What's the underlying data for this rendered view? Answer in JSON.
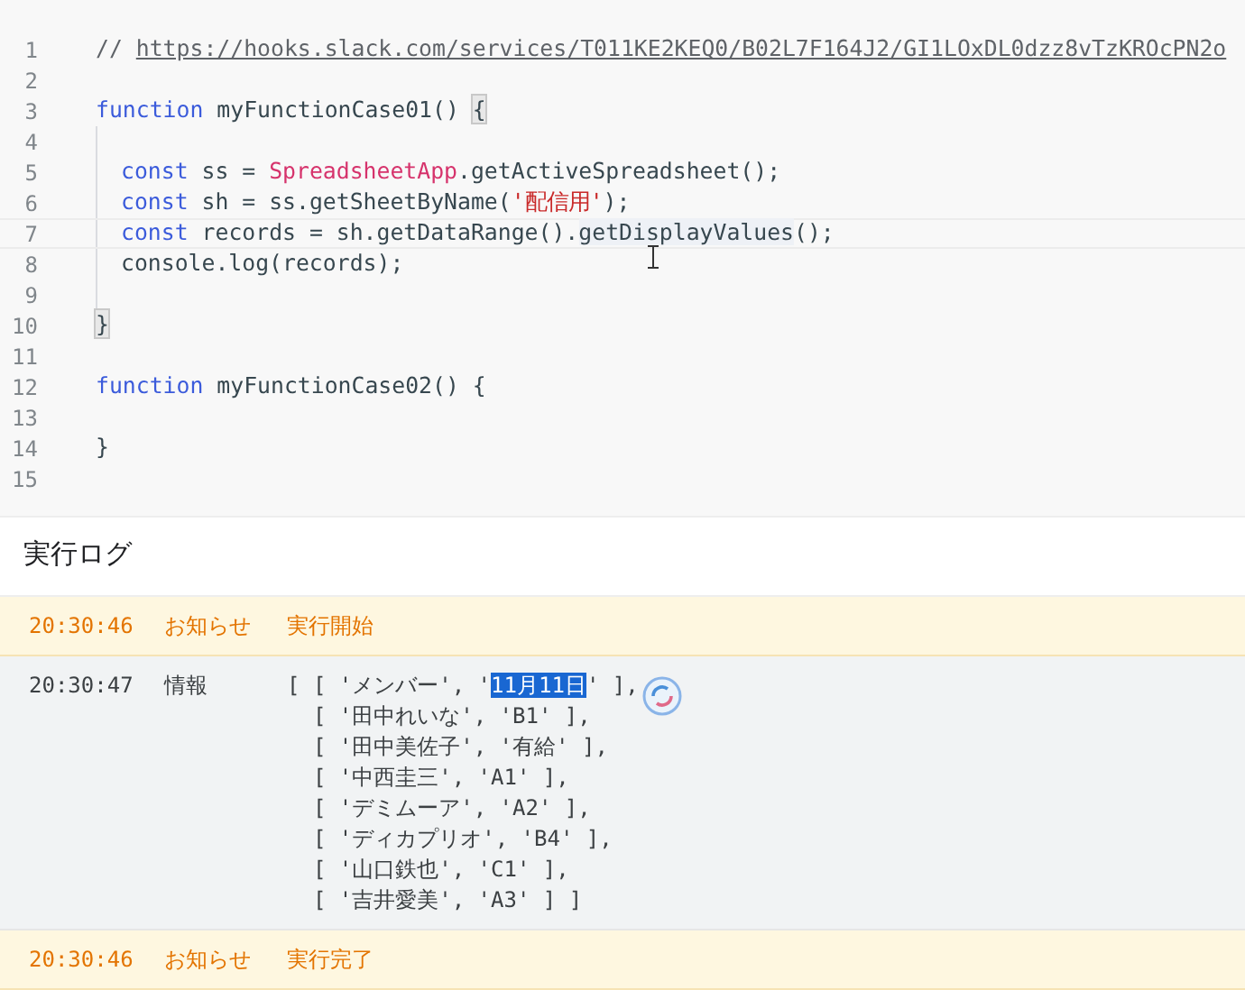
{
  "editor": {
    "lines": [
      {
        "number": "1",
        "current": false,
        "guide": false,
        "tokens": [
          {
            "kind": "comment",
            "text": "// "
          },
          {
            "kind": "link",
            "text": "https://hooks.slack.com/services/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"
          }
        ]
      },
      {
        "number": "2",
        "current": false,
        "guide": false
      },
      {
        "number": "3",
        "current": false,
        "guide": false,
        "tokens": [
          {
            "kind": "keyword",
            "text": "function"
          },
          {
            "kind": "plain",
            "text": " myFunctionCase01() "
          },
          {
            "kind": "match",
            "text": "{"
          }
        ]
      },
      {
        "number": "4",
        "current": false,
        "guide": true
      },
      {
        "number": "5",
        "current": false,
        "guide": true,
        "tokens": [
          {
            "kind": "keyword",
            "text": "const"
          },
          {
            "kind": "plain",
            "text": " ss = "
          },
          {
            "kind": "class",
            "text": "SpreadsheetApp"
          },
          {
            "kind": "plain",
            "text": ".getActiveSpreadsheet();"
          }
        ]
      },
      {
        "number": "6",
        "current": false,
        "guide": true,
        "tokens": [
          {
            "kind": "keyword",
            "text": "const"
          },
          {
            "kind": "plain",
            "text": " sh = ss.getSheetByName("
          },
          {
            "kind": "string",
            "text": "'配信用'"
          },
          {
            "kind": "plain",
            "text": ");"
          }
        ]
      },
      {
        "number": "7",
        "current": true,
        "guide": true,
        "tokens": [
          {
            "kind": "keyword",
            "text": "const"
          },
          {
            "kind": "plain",
            "text": " records = sh.getDataRange()."
          },
          {
            "kind": "word",
            "text": "getDisplayValues"
          },
          {
            "kind": "plain",
            "text": "();"
          }
        ]
      },
      {
        "number": "8",
        "current": false,
        "guide": true,
        "tokens": [
          {
            "kind": "plain",
            "text": "console.log(records);"
          }
        ]
      },
      {
        "number": "9",
        "current": false,
        "guide": true
      },
      {
        "number": "10",
        "current": false,
        "guide": false,
        "tokens": [
          {
            "kind": "match",
            "text": "}"
          }
        ]
      },
      {
        "number": "11",
        "current": false,
        "guide": false
      },
      {
        "number": "12",
        "current": false,
        "guide": false,
        "tokens": [
          {
            "kind": "keyword",
            "text": "function"
          },
          {
            "kind": "plain",
            "text": " myFunctionCase02() {"
          }
        ]
      },
      {
        "number": "13",
        "current": false,
        "guide": false
      },
      {
        "number": "14",
        "current": false,
        "guide": false,
        "tokens": [
          {
            "kind": "plain",
            "text": "}"
          }
        ]
      },
      {
        "number": "15",
        "current": false,
        "guide": false
      }
    ]
  },
  "log": {
    "title": "実行ログ",
    "entries": [
      {
        "kind": "notice",
        "time": "20:30:46",
        "type": "お知らせ",
        "lines": [
          {
            "before": "実行開始"
          }
        ]
      },
      {
        "kind": "info",
        "time": "20:30:47",
        "type": "情報",
        "lines": [
          {
            "before": "[ [ 'メンバー', '",
            "selected": "11月11日",
            "after": "' ],"
          },
          {
            "before": "  [ '田中れいな', 'B1' ],"
          },
          {
            "before": "  [ '田中美佐子', '有給' ],"
          },
          {
            "before": "  [ '中西圭三', 'A1' ],"
          },
          {
            "before": "  [ 'デミムーア', 'A2' ],"
          },
          {
            "before": "  [ 'ディカプリオ', 'B4' ],"
          },
          {
            "before": "  [ '山口鉄也', 'C1' ],"
          },
          {
            "before": "  [ '吉井愛美', 'A3' ] ]"
          }
        ]
      },
      {
        "kind": "notice",
        "time": "20:30:46",
        "type": "お知らせ",
        "lines": [
          {
            "before": "実行完了"
          }
        ]
      }
    ]
  }
}
